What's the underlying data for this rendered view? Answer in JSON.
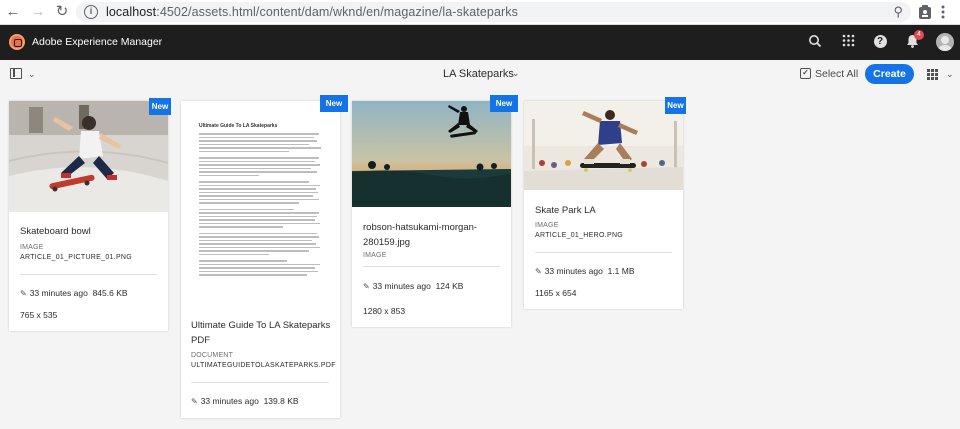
{
  "browser": {
    "url_host": "localhost",
    "url_path": ":4502/assets.html/content/dam/wknd/en/magazine/la-skateparks"
  },
  "header": {
    "app_title": "Adobe Experience Manager",
    "notification_count": "4"
  },
  "action_bar": {
    "folder_title": "LA Skateparks",
    "select_all_label": "Select All",
    "create_label": "Create"
  },
  "badges": {
    "new_label": "New"
  },
  "cards": [
    {
      "title": "Skateboard bowl",
      "type": "IMAGE",
      "filename": "ARTICLE_01_PICTURE_01.PNG",
      "modified": "33 minutes ago",
      "size": "845.6 KB",
      "dimensions": "765 x 535"
    },
    {
      "title_line1": "Ultimate Guide To LA Skateparks",
      "title_line2": "PDF",
      "type": "DOCUMENT",
      "filename": "ULTIMATEGUIDETOLASKATEPARKS.PDF",
      "modified": "33 minutes ago",
      "size": "139.8 KB",
      "doc_heading": "Ultimate Guide To LA Skateparks"
    },
    {
      "title_line1": "robson-hatsukami-morgan-",
      "title_line2": "280159.jpg",
      "type": "IMAGE",
      "modified": "33 minutes ago",
      "size": "124 KB",
      "dimensions": "1280 x 853"
    },
    {
      "title": "Skate Park LA",
      "type": "IMAGE",
      "filename": "ARTICLE_01_HERO.PNG",
      "modified": "33 minutes ago",
      "size": "1.1 MB",
      "dimensions": "1165 x 654"
    }
  ],
  "colors": {
    "accent": "#1473e6",
    "header_bg": "#1e1e1e",
    "page_bg": "#f4f4f4"
  }
}
